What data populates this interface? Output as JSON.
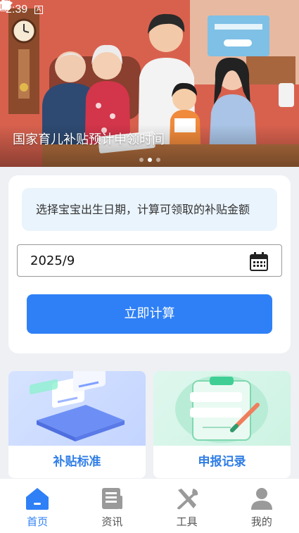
{
  "status_bar": {
    "time": "2:39",
    "indicator": "A"
  },
  "banner": {
    "caption": "国家育儿补贴预计申领时间",
    "slide_count": 3,
    "active_slide": 1
  },
  "calculator": {
    "tip": "选择宝宝出生日期，计算可领取的补贴金额",
    "date_value": "2025/9",
    "button_label": "立即计算"
  },
  "features": [
    {
      "label": "补贴标准",
      "icon": "documents-illustration"
    },
    {
      "label": "申报记录",
      "icon": "clipboard-illustration"
    }
  ],
  "tabbar": {
    "active_index": 0,
    "items": [
      {
        "label": "首页",
        "icon": "home-icon"
      },
      {
        "label": "资讯",
        "icon": "news-icon"
      },
      {
        "label": "工具",
        "icon": "tools-icon"
      },
      {
        "label": "我的",
        "icon": "profile-icon"
      }
    ]
  },
  "colors": {
    "accent": "#2f80f6",
    "tip_bg": "#eaf4fd",
    "feature_label": "#2f7de6",
    "inactive_icon": "#9a9a9a"
  }
}
